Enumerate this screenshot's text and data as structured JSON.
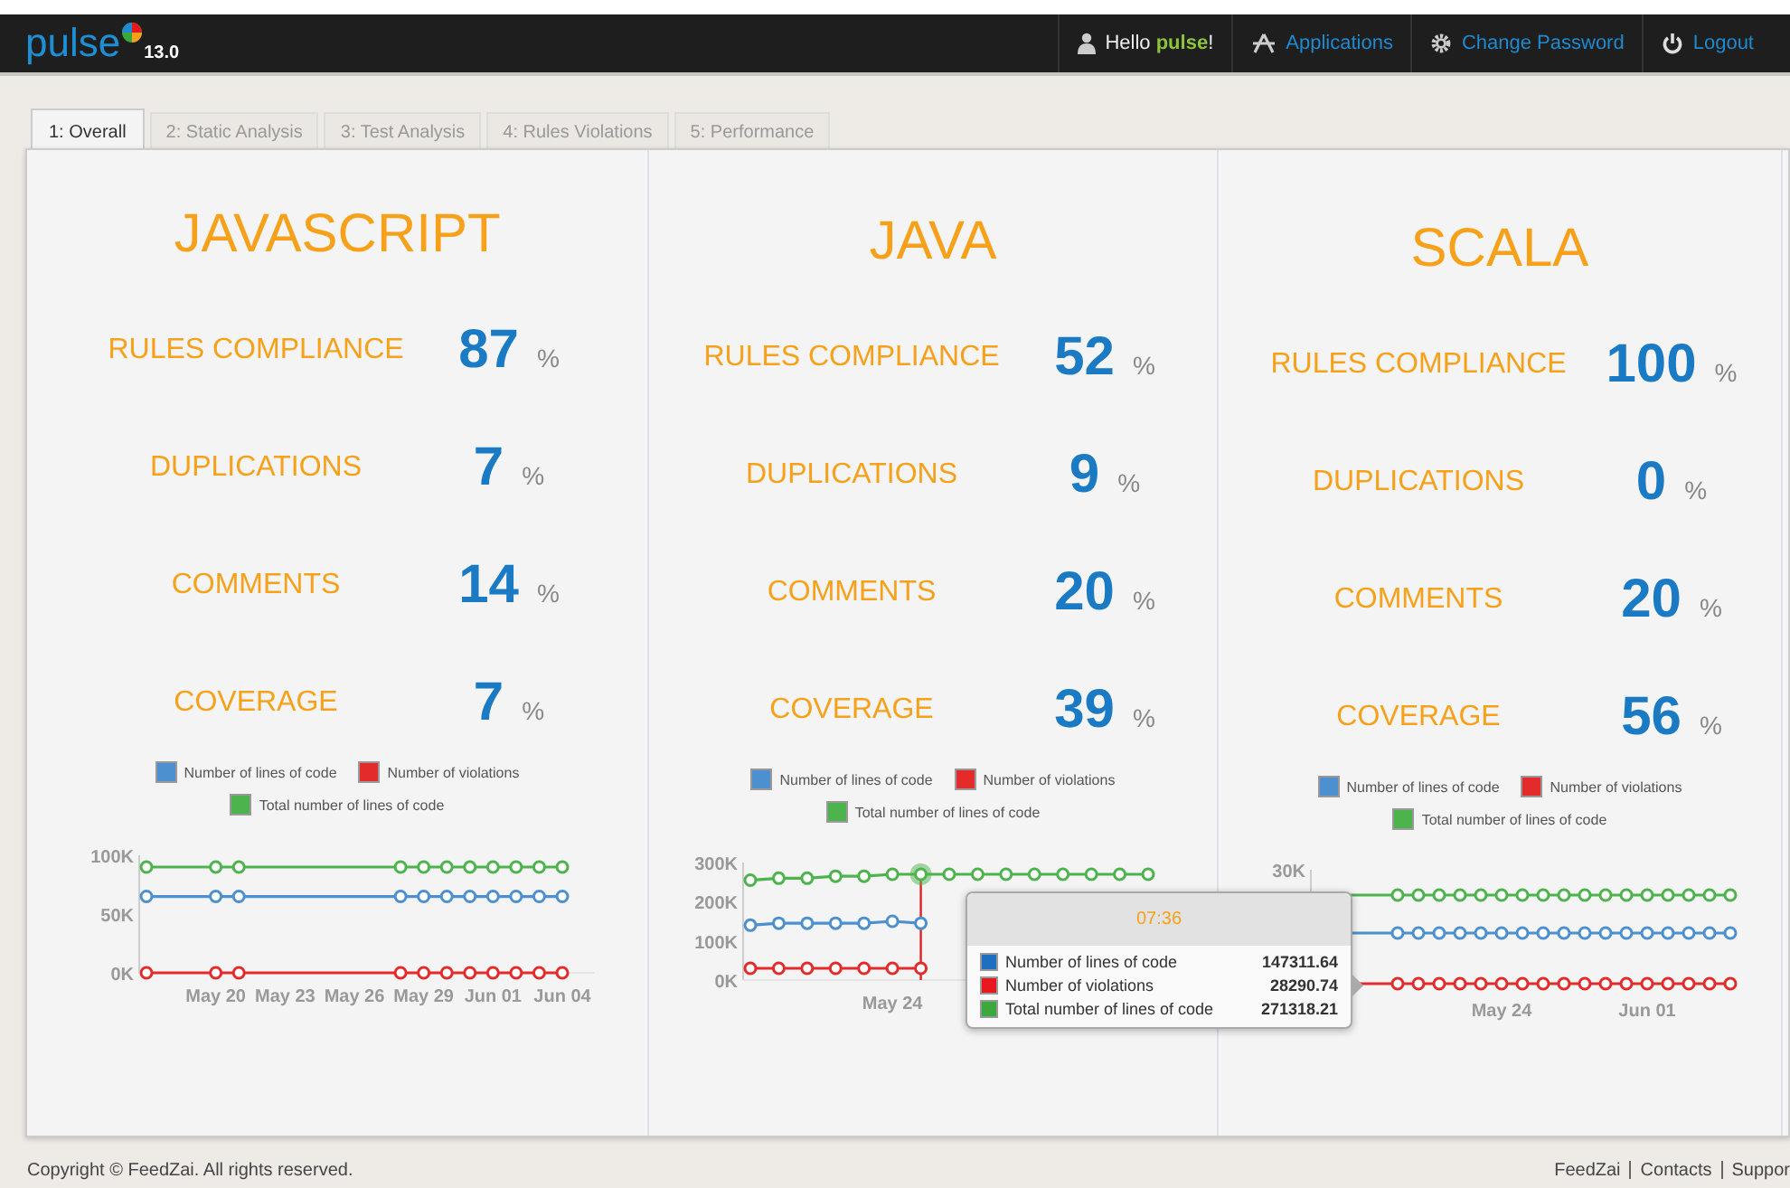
{
  "header": {
    "logo": "pulse",
    "version": "13.0",
    "greeting": "Hello",
    "user": "pulse",
    "greeting_end": "!",
    "links": [
      {
        "kind": "applications",
        "label": "Applications"
      },
      {
        "kind": "password",
        "label": "Change Password"
      },
      {
        "kind": "logout",
        "label": "Logout"
      }
    ]
  },
  "tabs": [
    {
      "label": "1: Overall",
      "selected": true
    },
    {
      "label": "2: Static Analysis",
      "selected": false
    },
    {
      "label": "3: Test Analysis",
      "selected": false
    },
    {
      "label": "4: Rules Violations",
      "selected": false
    },
    {
      "label": "5: Performance",
      "selected": false
    }
  ],
  "languages": [
    {
      "title": "JAVASCRIPT",
      "metrics": [
        {
          "label": "RULES COMPLIANCE",
          "value": "87",
          "unit": "%"
        },
        {
          "label": "DUPLICATIONS",
          "value": "7",
          "unit": "%"
        },
        {
          "label": "COMMENTS",
          "value": "14",
          "unit": "%"
        },
        {
          "label": "COVERAGE",
          "value": "7",
          "unit": "%"
        }
      ],
      "chart_data": {
        "type": "line",
        "categories": [
          null,
          null,
          null,
          "May 20",
          null,
          null,
          "May 23",
          null,
          null,
          "May 26",
          null,
          null,
          "May 29",
          null,
          null,
          "Jun 01",
          null,
          null,
          "Jun 04"
        ],
        "ylim": [
          0,
          100000
        ],
        "yticks": [
          {
            "value": 0,
            "label": "0K"
          },
          {
            "value": 50000,
            "label": "50K"
          },
          {
            "value": 100000,
            "label": "100K"
          }
        ],
        "series": [
          {
            "name": "Number of lines of code",
            "color": "#4d90cf",
            "marker": "o",
            "values": [
              65000,
              null,
              null,
              65000,
              65000,
              null,
              null,
              null,
              null,
              null,
              null,
              65000,
              65000,
              65000,
              65000,
              65000,
              65000,
              65000,
              65000
            ]
          },
          {
            "name": "Number of violations",
            "color": "#e42b2b",
            "marker": "o",
            "values": [
              0,
              null,
              null,
              0,
              0,
              null,
              null,
              null,
              null,
              null,
              null,
              0,
              0,
              0,
              0,
              0,
              0,
              0,
              0
            ]
          },
          {
            "name": "Total number of lines of code",
            "color": "#4db34d",
            "marker": "o",
            "values": [
              90000,
              null,
              null,
              90000,
              90000,
              null,
              null,
              null,
              null,
              null,
              null,
              90000,
              90000,
              90000,
              90000,
              90000,
              90000,
              90000,
              90000
            ]
          }
        ]
      }
    },
    {
      "title": "JAVA",
      "metrics": [
        {
          "label": "RULES COMPLIANCE",
          "value": "52",
          "unit": "%"
        },
        {
          "label": "DUPLICATIONS",
          "value": "9",
          "unit": "%"
        },
        {
          "label": "COMMENTS",
          "value": "20",
          "unit": "%"
        },
        {
          "label": "COVERAGE",
          "value": "39",
          "unit": "%"
        }
      ],
      "chart_data": {
        "type": "line",
        "categories": [
          null,
          null,
          null,
          null,
          null,
          "May 24",
          null,
          null,
          null,
          null,
          null,
          null,
          null,
          null,
          null
        ],
        "ylim": [
          0,
          300000
        ],
        "yticks": [
          {
            "value": 0,
            "label": "0K"
          },
          {
            "value": 100000,
            "label": "100K"
          },
          {
            "value": 200000,
            "label": "200K"
          },
          {
            "value": 300000,
            "label": "300K"
          }
        ],
        "series": [
          {
            "name": "Number of lines of code",
            "color": "#4d90cf",
            "marker": "o",
            "values": [
              140000,
              145000,
              145000,
              145000,
              145000,
              150000,
              145000,
              null,
              null,
              null,
              null,
              null,
              null,
              null,
              null
            ]
          },
          {
            "name": "Number of violations",
            "color": "#e42b2b",
            "marker": "o",
            "values": [
              30000,
              30000,
              30000,
              30000,
              30000,
              30000,
              30000,
              null,
              null,
              null,
              null,
              null,
              null,
              null,
              null
            ]
          },
          {
            "name": "Total number of lines of code",
            "color": "#4db34d",
            "marker": "o",
            "values": [
              255000,
              260000,
              260000,
              265000,
              265000,
              270000,
              270000,
              270000,
              270000,
              270000,
              270000,
              270000,
              270000,
              270000,
              270000
            ]
          }
        ]
      },
      "tooltip": {
        "title": "07:36",
        "rows": [
          {
            "label": "Number of lines of code",
            "value": "147311.64",
            "color": "#1f6fc0"
          },
          {
            "label": "Number of violations",
            "value": "28290.74",
            "color": "#e8191e"
          },
          {
            "label": "Total number of lines of code",
            "value": "271318.21",
            "color": "#3aa83a"
          }
        ]
      }
    },
    {
      "title": "SCALA",
      "metrics": [
        {
          "label": "RULES COMPLIANCE",
          "value": "100",
          "unit": "%"
        },
        {
          "label": "DUPLICATIONS",
          "value": "0",
          "unit": "%"
        },
        {
          "label": "COMMENTS",
          "value": "20",
          "unit": "%"
        },
        {
          "label": "COVERAGE",
          "value": "56",
          "unit": "%"
        }
      ],
      "chart_picture": {
        "legend": [
          {
            "name": "Number of lines of code",
            "color": "#4d90cf"
          },
          {
            "name": "Number of violations",
            "color": "#e42b2b"
          },
          {
            "name": "Total number of lines of code",
            "color": "#4db34d"
          }
        ],
        "y_labels": [
          "30K"
        ],
        "x_labels": [
          "May 24",
          "Jun 01"
        ]
      }
    }
  ],
  "footer": {
    "copyright": "Copyright © FeedZai. All rights reserved.",
    "links": [
      "FeedZai",
      "Contacts",
      "Suppor"
    ]
  }
}
